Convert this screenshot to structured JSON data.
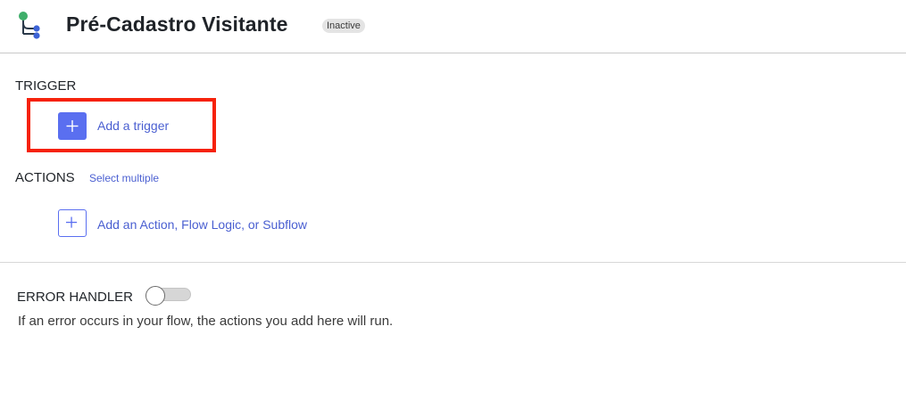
{
  "header": {
    "flow_icon": "flow-branch-icon",
    "title": "Pré-Cadastro Visitante",
    "status": "Inactive"
  },
  "trigger": {
    "heading": "TRIGGER",
    "add_label": "Add a trigger",
    "add_icon": "plus-icon"
  },
  "actions": {
    "heading": "ACTIONS",
    "select_multiple": "Select multiple",
    "add_label": "Add an Action, Flow Logic, or Subflow",
    "add_icon": "plus-icon"
  },
  "error_handler": {
    "heading": "ERROR HANDLER",
    "enabled": false,
    "description": "If an error occurs in your flow, the actions you add here will run."
  },
  "colors": {
    "accent": "#5a6ff0",
    "link": "#4a5fd1",
    "highlight": "#f6220a",
    "icon_green": "#3fae6a",
    "icon_blue": "#3d63d6"
  }
}
